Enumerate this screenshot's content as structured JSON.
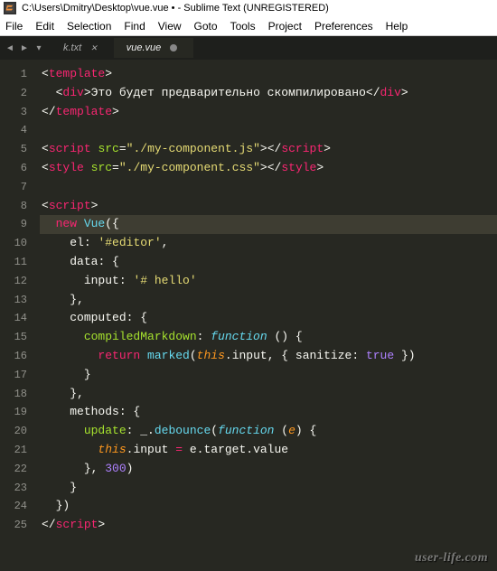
{
  "window": {
    "title": "C:\\Users\\Dmitry\\Desktop\\vue.vue • - Sublime Text (UNREGISTERED)"
  },
  "menu": {
    "file": "File",
    "edit": "Edit",
    "selection": "Selection",
    "find": "Find",
    "view": "View",
    "goto": "Goto",
    "tools": "Tools",
    "project": "Project",
    "preferences": "Preferences",
    "help": "Help"
  },
  "tabs": {
    "items": [
      {
        "label": "k.txt",
        "active": false,
        "dirty": false
      },
      {
        "label": "vue.vue",
        "active": true,
        "dirty": true
      }
    ]
  },
  "editor": {
    "lines": [
      "1",
      "2",
      "3",
      "4",
      "5",
      "6",
      "7",
      "8",
      "9",
      "10",
      "11",
      "12",
      "13",
      "14",
      "15",
      "16",
      "17",
      "18",
      "19",
      "20",
      "21",
      "22",
      "23",
      "24",
      "25"
    ],
    "highlight_line": 9,
    "fold_markers": {
      "9": "{",
      "24": "}"
    },
    "code": {
      "l1": {
        "open": "<",
        "tag": "template",
        "close": ">"
      },
      "l2": {
        "indent": "  ",
        "o1": "<",
        "div": "div",
        "c1": ">",
        "text": "Это будет предварительно скомпилировано",
        "o2": "</",
        "c2": ">"
      },
      "l3": {
        "o": "</",
        "tag": "template",
        "c": ">"
      },
      "l4": {
        "blank": ""
      },
      "l5": {
        "o": "<",
        "tag": "script",
        "sp": " ",
        "attr": "src",
        "eq": "=",
        "q": "\"",
        "val": "./my-component.js",
        "c": ">",
        "o2": "</",
        "c2": ">"
      },
      "l6": {
        "o": "<",
        "tag": "style",
        "sp": " ",
        "attr": "src",
        "eq": "=",
        "q": "\"",
        "val": "./my-component.css",
        "c": ">",
        "o2": "</",
        "c2": ">"
      },
      "l7": {
        "blank": ""
      },
      "l8": {
        "o": "<",
        "tag": "script",
        "c": ">"
      },
      "l9": {
        "indent": "  ",
        "new": "new",
        "sp": " ",
        "vue": "Vue",
        "paren": "({"
      },
      "l10": {
        "indent": "    ",
        "key": "el",
        "colon": ": ",
        "val": "'#editor'",
        "comma": ","
      },
      "l11": {
        "indent": "    ",
        "key": "data",
        "colon": ": {",
        "rest": ""
      },
      "l12": {
        "indent": "      ",
        "key": "input",
        "colon": ": ",
        "val": "'# hello'"
      },
      "l13": {
        "indent": "    ",
        "brace": "},"
      },
      "l14": {
        "indent": "    ",
        "key": "computed",
        "colon": ": {"
      },
      "l15": {
        "indent": "      ",
        "name": "compiledMarkdown",
        "colon": ": ",
        "fn": "function",
        "sp": " ",
        "paren": "() {"
      },
      "l16": {
        "indent": "        ",
        "ret": "return",
        "sp": " ",
        "marked": "marked",
        "p1": "(",
        "this": "this",
        "dot": ".input, { ",
        "san": "sanitize",
        "col2": ": ",
        "true": "true",
        "end": " })"
      },
      "l17": {
        "indent": "      ",
        "brace": "}"
      },
      "l18": {
        "indent": "    ",
        "brace": "},"
      },
      "l19": {
        "indent": "    ",
        "key": "methods",
        "colon": ": {"
      },
      "l20": {
        "indent": "      ",
        "name": "update",
        "colon": ": _.",
        "deb": "debounce",
        "p1": "(",
        "fn": "function",
        "sp": " (",
        "e": "e",
        "paren": ") {"
      },
      "l21": {
        "indent": "        ",
        "this": "this",
        "rest": ".input ",
        "eq": "=",
        "rest2": " e.target.value"
      },
      "l22": {
        "indent": "      ",
        "b1": "}, ",
        "num": "300",
        "b2": ")"
      },
      "l23": {
        "indent": "    ",
        "brace": "}"
      },
      "l24": {
        "indent": "  ",
        "brace": "})"
      },
      "l25": {
        "o": "</",
        "tag": "script",
        "c": ">"
      }
    }
  },
  "watermark": "user-life.com"
}
